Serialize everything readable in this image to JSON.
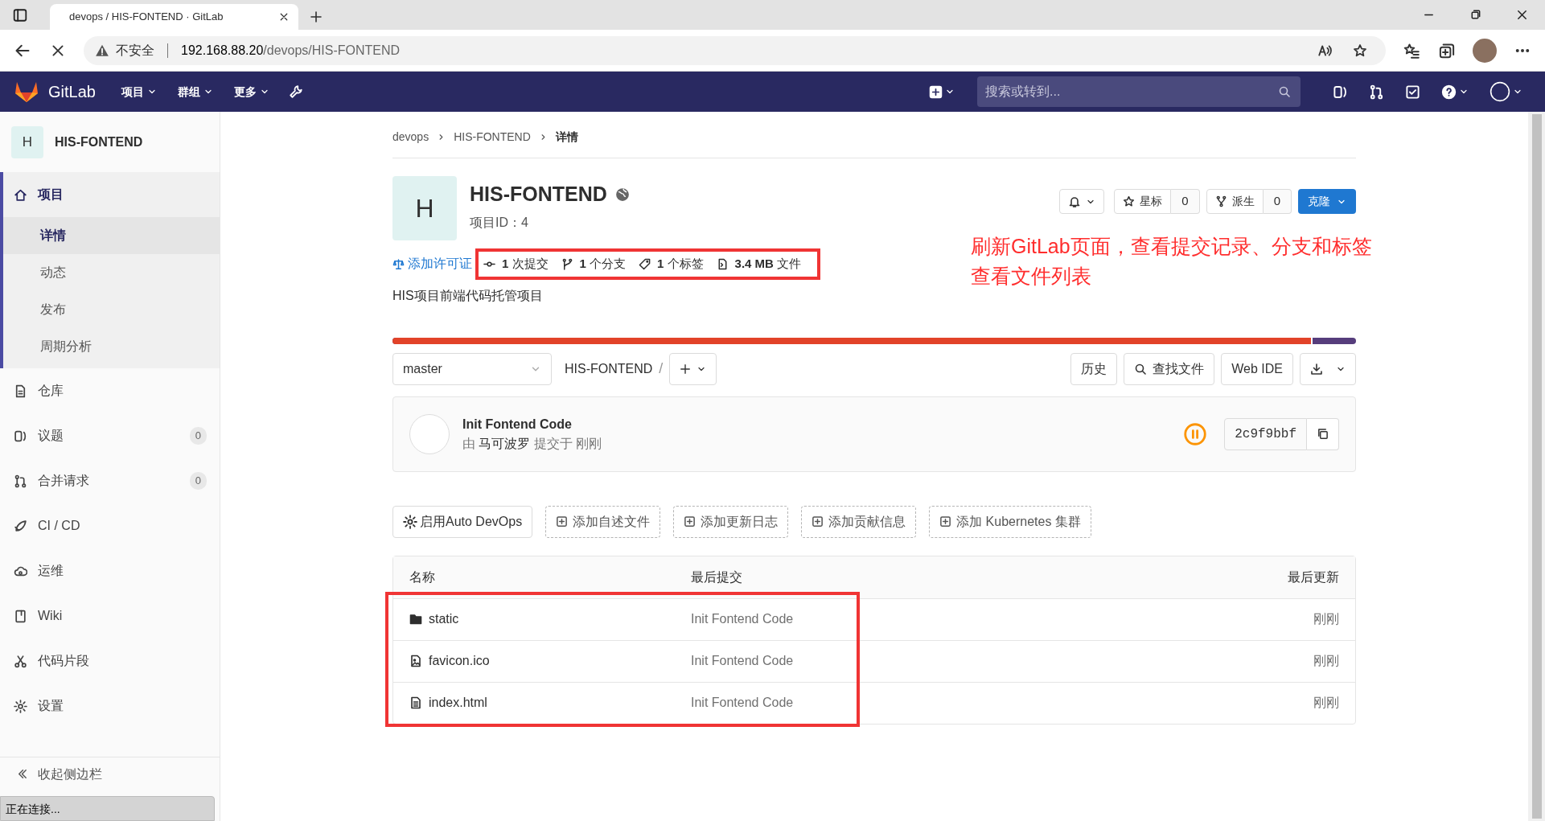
{
  "browser": {
    "tab_title": "devops / HIS-FONTEND · GitLab",
    "loading": true,
    "security_label": "不安全",
    "url_host": "192.168.88.20",
    "url_path": "/devops/HIS-FONTEND"
  },
  "header": {
    "logo_text": "GitLab",
    "menus": [
      "项目",
      "群组",
      "更多"
    ],
    "search_placeholder": "搜索或转到..."
  },
  "sidebar": {
    "project_initial": "H",
    "project_name": "HIS-FONTEND",
    "items": [
      {
        "label": "项目",
        "selected": true,
        "children": [
          {
            "label": "详情",
            "selected": true
          },
          {
            "label": "动态",
            "selected": false
          },
          {
            "label": "发布",
            "selected": false
          },
          {
            "label": "周期分析",
            "selected": false
          }
        ]
      },
      {
        "label": "仓库",
        "selected": false
      },
      {
        "label": "议题",
        "count": "0",
        "selected": false
      },
      {
        "label": "合并请求",
        "count": "0",
        "selected": false
      },
      {
        "label": "CI / CD",
        "selected": false
      },
      {
        "label": "运维",
        "selected": false
      },
      {
        "label": "Wiki",
        "selected": false
      },
      {
        "label": "代码片段",
        "selected": false
      },
      {
        "label": "设置",
        "selected": false
      }
    ],
    "collapse_label": "收起侧边栏"
  },
  "breadcrumb": [
    "devops",
    "HIS-FONTEND",
    "详情"
  ],
  "project": {
    "initial": "H",
    "name": "HIS-FONTEND",
    "id_label": "项目ID：4",
    "star_label": "星标",
    "star_count": "0",
    "fork_label": "派生",
    "fork_count": "0",
    "clone_label": "克隆",
    "license_link": "添加许可证",
    "description": "HIS项目前端代码托管项目"
  },
  "stats": {
    "highlighted": true,
    "items": [
      "**1** 次提交",
      "**1** 个分支",
      "**1** 个标签",
      "**3.4 MB** 文件"
    ]
  },
  "annotation": [
    "刷新GitLab页面，查看提交记录、分支和标签",
    "查看文件列表"
  ],
  "language_bar": {
    "level": 0.955,
    "segments": [
      {
        "color": "#e24329"
      },
      {
        "color": "#563d7c"
      }
    ]
  },
  "repo_toolbar": {
    "branch": "master",
    "path": "HIS-FONTEND",
    "separator": "/",
    "buttons": [
      "历史",
      "查找文件",
      "Web IDE"
    ]
  },
  "commit": {
    "title": "Init Fontend Code",
    "by": "由",
    "author": "马可波罗",
    "when": "提交于 刚刚",
    "pipeline": {
      "kind": "paused"
    },
    "sha": "2c9f9bbf"
  },
  "actions": [
    {
      "kind": "solid",
      "label": "启用Auto DevOps"
    },
    {
      "kind": "dashed",
      "label": "添加自述文件"
    },
    {
      "kind": "dashed",
      "label": "添加更新日志"
    },
    {
      "kind": "dashed",
      "label": "添加贡献信息"
    },
    {
      "kind": "dashed",
      "label": "添加 Kubernetes 集群"
    }
  ],
  "files": {
    "highlighted": true,
    "columns": [
      "名称",
      "最后提交",
      "最后更新"
    ],
    "rows": [
      {
        "kind": "folder",
        "name": "static",
        "commit": "Init Fontend Code",
        "updated": "刚刚"
      },
      {
        "kind": "image",
        "name": "favicon.ico",
        "commit": "Init Fontend Code",
        "updated": "刚刚"
      },
      {
        "kind": "file",
        "name": "index.html",
        "commit": "Init Fontend Code",
        "updated": "刚刚"
      }
    ]
  },
  "status_bar": "正在连接..."
}
